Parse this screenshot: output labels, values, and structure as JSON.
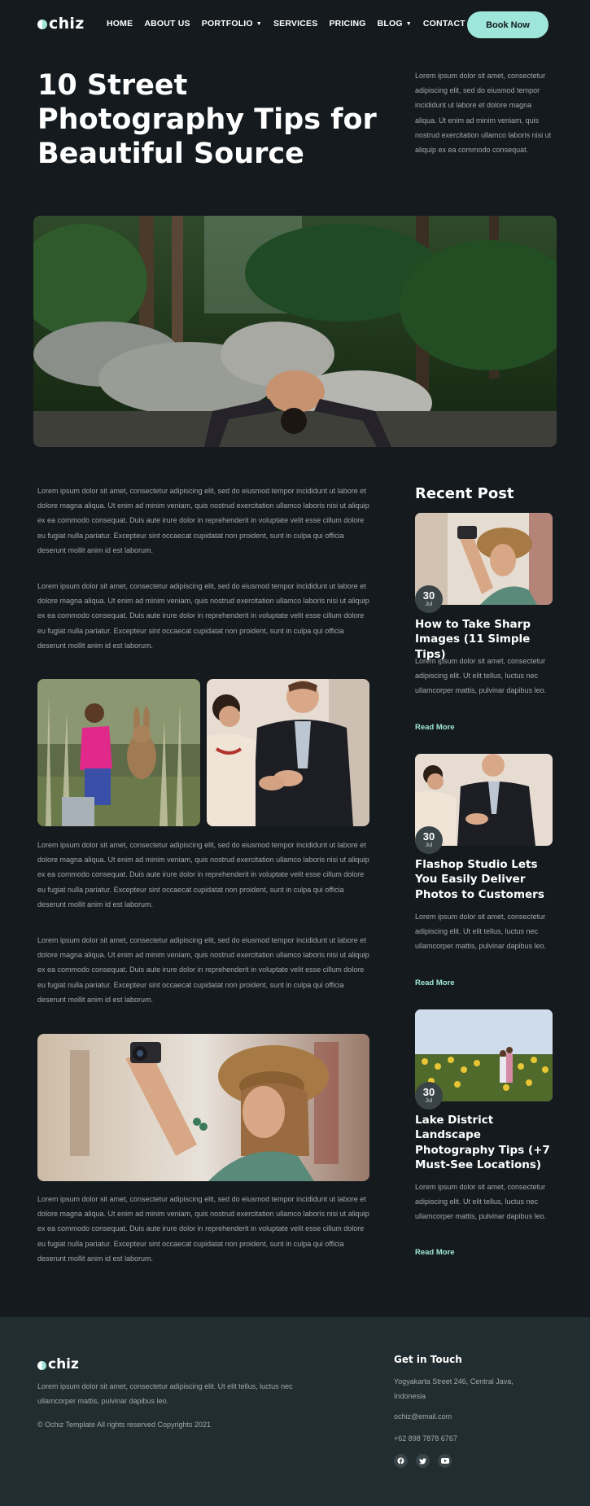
{
  "nav": {
    "logo_text": "chiz",
    "items": [
      {
        "label": "HOME",
        "dropdown": false
      },
      {
        "label": "ABOUT US",
        "dropdown": false
      },
      {
        "label": "PORTFOLIO",
        "dropdown": true
      },
      {
        "label": "SERVICES",
        "dropdown": false
      },
      {
        "label": "PRICING",
        "dropdown": false
      },
      {
        "label": "BLOG",
        "dropdown": true
      },
      {
        "label": "CONTACT US",
        "dropdown": false
      }
    ],
    "cta": "Book Now"
  },
  "hero": {
    "title": "10 Street Photography Tips for Beautiful Source",
    "intro": "Lorem ipsum dolor sit amet, consectetur adipiscing elit, sed do eiusmod tempor incididunt ut labore et dolore magna aliqua. Ut enim ad minim veniam, quis nostrud exercitation ullamco laboris nisi ut aliquip ex ea commodo consequat."
  },
  "article": {
    "paragraphs": [
      "Lorem ipsum dolor sit amet, consectetur adipiscing elit, sed do eiusmod tempor incididunt ut labore et dolore magna aliqua. Ut enim ad minim veniam, quis nostrud exercitation ullamco laboris nisi ut aliquip ex ea commodo consequat. Duis aute irure dolor in reprehenderit in voluptate velit esse cillum dolore eu fugiat nulla pariatur. Excepteur sint occaecat cupidatat non proident, sunt in culpa qui officia deserunt mollit anim id est laborum.",
      "Lorem ipsum dolor sit amet, consectetur adipiscing elit, sed do eiusmod tempor incididunt ut labore et dolore magna aliqua. Ut enim ad minim veniam, quis nostrud exercitation ullamco laboris nisi ut aliquip ex ea commodo consequat. Duis aute irure dolor in reprehenderit in voluptate velit esse cillum dolore eu fugiat nulla pariatur. Excepteur sint occaecat cupidatat non proident, sunt in culpa qui officia deserunt mollit anim id est laborum.",
      "Lorem ipsum dolor sit amet, consectetur adipiscing elit, sed do eiusmod tempor incididunt ut labore et dolore magna aliqua. Ut enim ad minim veniam, quis nostrud exercitation ullamco laboris nisi ut aliquip ex ea commodo consequat. Duis aute irure dolor in reprehenderit in voluptate velit esse cillum dolore eu fugiat nulla pariatur. Excepteur sint occaecat cupidatat non proident, sunt in culpa qui officia deserunt mollit anim id est laborum.",
      "Lorem ipsum dolor sit amet, consectetur adipiscing elit, sed do eiusmod tempor incididunt ut labore et dolore magna aliqua. Ut enim ad minim veniam, quis nostrud exercitation ullamco laboris nisi ut aliquip ex ea commodo consequat. Duis aute irure dolor in reprehenderit in voluptate velit esse cillum dolore eu fugiat nulla pariatur. Excepteur sint occaecat cupidatat non proident, sunt in culpa qui officia deserunt mollit anim id est laborum.",
      "Lorem ipsum dolor sit amet, consectetur adipiscing elit, sed do eiusmod tempor incididunt ut labore et dolore magna aliqua. Ut enim ad minim veniam, quis nostrud exercitation ullamco laboris nisi ut aliquip ex ea commodo consequat. Duis aute irure dolor in reprehenderit in voluptate velit esse cillum dolore eu fugiat nulla pariatur. Excepteur sint occaecat cupidatat non proident, sunt in culpa qui officia deserunt mollit anim id est laborum."
    ]
  },
  "sidebar": {
    "title": "Recent Post",
    "posts": [
      {
        "day": "30",
        "month": "Jul",
        "title": "How to Take Sharp Images (11 Simple Tips)",
        "excerpt": "Lorem ipsum dolor sit amet, consectetur adipiscing elit. Ut elit tellus, luctus nec ullamcorper mattis, pulvinar dapibus leo.",
        "link": "Read More"
      },
      {
        "day": "30",
        "month": "Jul",
        "title": "Flashop Studio Lets You Easily Deliver Photos to Customers",
        "excerpt": "Lorem ipsum dolor sit amet, consectetur adipiscing elit. Ut elit tellus, luctus nec ullamcorper mattis, pulvinar dapibus leo.",
        "link": "Read More"
      },
      {
        "day": "30",
        "month": "Jul",
        "title": "Lake District Landscape Photography Tips (+7 Must-See Locations)",
        "excerpt": "Lorem ipsum dolor sit amet, consectetur adipiscing elit. Ut elit tellus, luctus nec ullamcorper mattis, pulvinar dapibus leo.",
        "link": "Read More"
      }
    ]
  },
  "footer": {
    "logo_text": "chiz",
    "about": "Lorem ipsum dolor sit amet, consectetur adipiscing elit. Ut elit tellus, luctus nec ullamcorper mattis, pulvinar dapibus leo.",
    "copyright": "© Ochiz Template All rights reserved Copyrights 2021",
    "contact_title": "Get in Touch",
    "address": "Yogyakarta Street 246, Central Java, Indonesia",
    "email": "ochiz@email.com",
    "phone": "+62 898 7878 6767",
    "social": [
      "facebook-icon",
      "twitter-icon",
      "youtube-icon"
    ]
  },
  "colors": {
    "background": "#141a1d",
    "accent": "#9fe6da",
    "footer_bg": "#212d30",
    "body_text": "#a3a8ab"
  }
}
